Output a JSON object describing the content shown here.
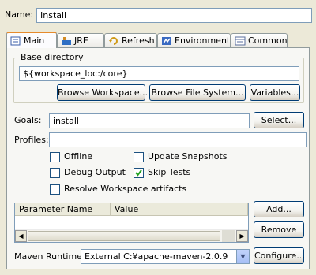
{
  "name": {
    "label": "Name:",
    "value": "Install"
  },
  "tabs": [
    {
      "label": "Main",
      "icon": "main-icon",
      "active": true
    },
    {
      "label": "JRE",
      "icon": "jre-icon"
    },
    {
      "label": "Refresh",
      "icon": "refresh-icon"
    },
    {
      "label": "Environment",
      "icon": "environment-icon"
    },
    {
      "label": "Common",
      "icon": "common-icon"
    }
  ],
  "base_directory": {
    "group_label": "Base directory",
    "value": "${workspace_loc:/core}",
    "buttons": {
      "browse_workspace": "Browse Workspace...",
      "browse_fs": "Browse File System...",
      "variables": "Variables..."
    }
  },
  "goals": {
    "label": "Goals:",
    "value": "install",
    "select_button": "Select..."
  },
  "profiles": {
    "label": "Profiles:",
    "value": ""
  },
  "options": {
    "offline": {
      "label": "Offline",
      "checked": false
    },
    "update_snapshots": {
      "label": "Update Snapshots",
      "checked": false
    },
    "debug_output": {
      "label": "Debug Output",
      "checked": false
    },
    "skip_tests": {
      "label": "Skip Tests",
      "checked": true
    },
    "resolve_workspace": {
      "label": "Resolve Workspace artifacts",
      "checked": false
    }
  },
  "parameters": {
    "columns": [
      "Parameter Name",
      "Value"
    ],
    "add_button": "Add...",
    "remove_button": "Remove"
  },
  "maven_runtime": {
    "label": "Maven Runtime:",
    "selected": "External C:¥apache-maven-2.0.9",
    "configure_button": "Configure..."
  },
  "colors": {
    "tab_accent": "#e68b2c",
    "field_border": "#7f9db9",
    "button_border": "#003c74"
  }
}
